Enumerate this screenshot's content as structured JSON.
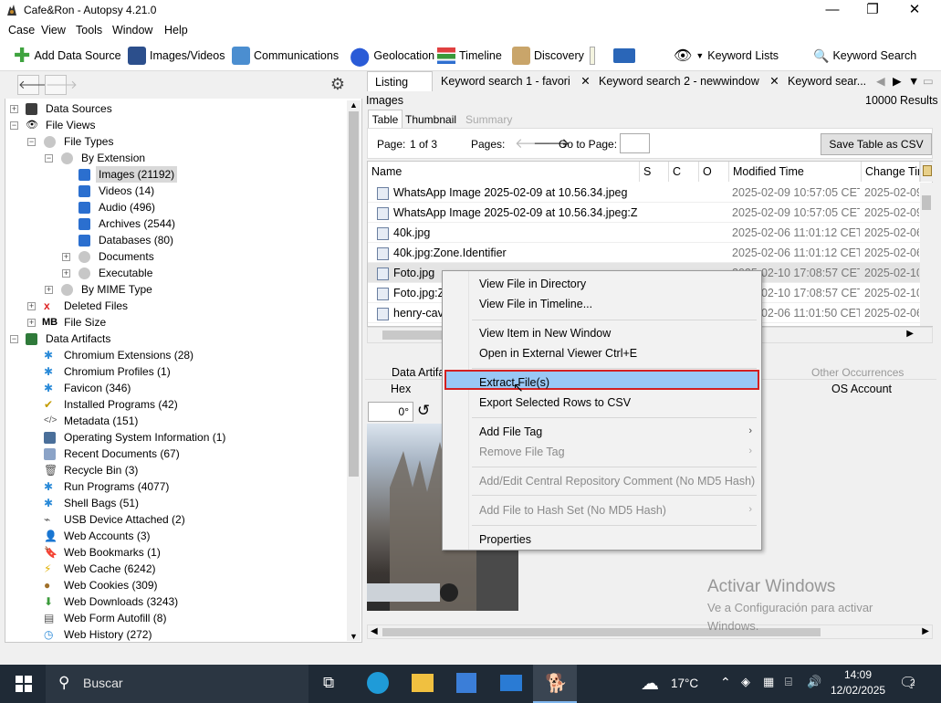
{
  "window": {
    "title": "Cafe&Ron - Autopsy 4.21.0"
  },
  "menu": [
    "Case",
    "View",
    "Tools",
    "Window",
    "Help"
  ],
  "toolbar": {
    "add_data_source": "Add Data Source",
    "images_videos": "Images/Videos",
    "communications": "Communications",
    "geolocation": "Geolocation",
    "timeline": "Timeline",
    "discovery": "Discovery",
    "keyword_lists": "Keyword Lists",
    "keyword_search": "Keyword Search"
  },
  "tree": {
    "data_sources": "Data Sources",
    "file_views": "File Views",
    "file_types": "File Types",
    "by_extension": "By Extension",
    "images": "Images (21192)",
    "videos": "Videos (14)",
    "audio": "Audio (496)",
    "archives": "Archives (2544)",
    "databases": "Databases (80)",
    "documents": "Documents",
    "executable": "Executable",
    "by_mime": "By MIME Type",
    "deleted_files": "Deleted Files",
    "file_size_badge": "MB",
    "file_size": "File Size",
    "data_artifacts": "Data Artifacts",
    "artifacts": [
      "Chromium Extensions (28)",
      "Chromium Profiles (1)",
      "Favicon (346)",
      "Installed Programs (42)",
      "Metadata (151)",
      "Operating System Information (1)",
      "Recent Documents (67)",
      "Recycle Bin (3)",
      "Run Programs (4077)",
      "Shell Bags (51)",
      "USB Device Attached (2)",
      "Web Accounts (3)",
      "Web Bookmarks (1)",
      "Web Cache (6242)",
      "Web Cookies (309)",
      "Web Downloads (3243)",
      "Web Form Autofill (8)",
      "Web History (272)"
    ]
  },
  "result_tabs": {
    "listing": "Listing",
    "kw1": "Keyword search 1 - favori",
    "kw2": "Keyword search 2 - newwindow",
    "kw3": "Keyword sear..."
  },
  "results": {
    "section": "Images",
    "count": "10000",
    "count_label": "Results",
    "view_tabs": [
      "Table",
      "Thumbnail",
      "Summary"
    ],
    "page_label": "Page:",
    "page_value": "1 of 3",
    "pages_label": "Pages:",
    "goto_label": "Go to Page:",
    "save_csv": "Save Table as CSV",
    "columns": [
      "Name",
      "S",
      "C",
      "O",
      "Modified Time",
      "Change Tim"
    ],
    "rows": [
      {
        "name": "WhatsApp Image 2025-02-09 at 10.56.34.jpeg",
        "modified": "2025-02-09 10:57:05 CET",
        "change": "2025-02-09"
      },
      {
        "name": "WhatsApp Image 2025-02-09 at 10.56.34.jpeg:Zone.Identifier",
        "modified": "2025-02-09 10:57:05 CET",
        "change": "2025-02-09"
      },
      {
        "name": "40k.jpg",
        "modified": "2025-02-06 11:01:12 CET",
        "change": "2025-02-06"
      },
      {
        "name": "40k.jpg:Zone.Identifier",
        "modified": "2025-02-06 11:01:12 CET",
        "change": "2025-02-06"
      },
      {
        "name": "Foto.jpg",
        "modified": "2025-02-10 17:08:57 CET",
        "change": "2025-02-10"
      },
      {
        "name": "Foto.jpg:Zone.Identifier",
        "modified": "2025-02-10 17:08:57 CET",
        "change": "2025-02-10"
      },
      {
        "name": "henry-cavill.jpg",
        "modified": "2025-02-06 11:01:50 CET",
        "change": "2025-02-06"
      }
    ]
  },
  "bottom": {
    "data_artifacts_tab": "Data Artifacts",
    "other_occurrences": "Other Occurrences",
    "hex": "Hex",
    "os_account": "OS Account",
    "rotation": "0°"
  },
  "context_menu": {
    "view_in_directory": "View File in Directory",
    "view_in_timeline": "View File in Timeline...",
    "view_new_window": "View Item in New Window",
    "open_external": "Open in External Viewer  Ctrl+E",
    "extract": "Extract File(s)",
    "export_csv": "Export Selected Rows to CSV",
    "add_tag": "Add File Tag",
    "remove_tag": "Remove File Tag",
    "cr_comment": "Add/Edit Central Repository Comment (No MD5 Hash)",
    "hash_set": "Add File to Hash Set (No MD5 Hash)",
    "properties": "Properties"
  },
  "watermark": {
    "line1": "Activar Windows",
    "line2": "Ve a Configuración para activar",
    "line3": "Windows."
  },
  "taskbar": {
    "search": "Buscar",
    "temp": "17°C",
    "time": "14:09",
    "date": "12/02/2025",
    "notif": "2"
  }
}
